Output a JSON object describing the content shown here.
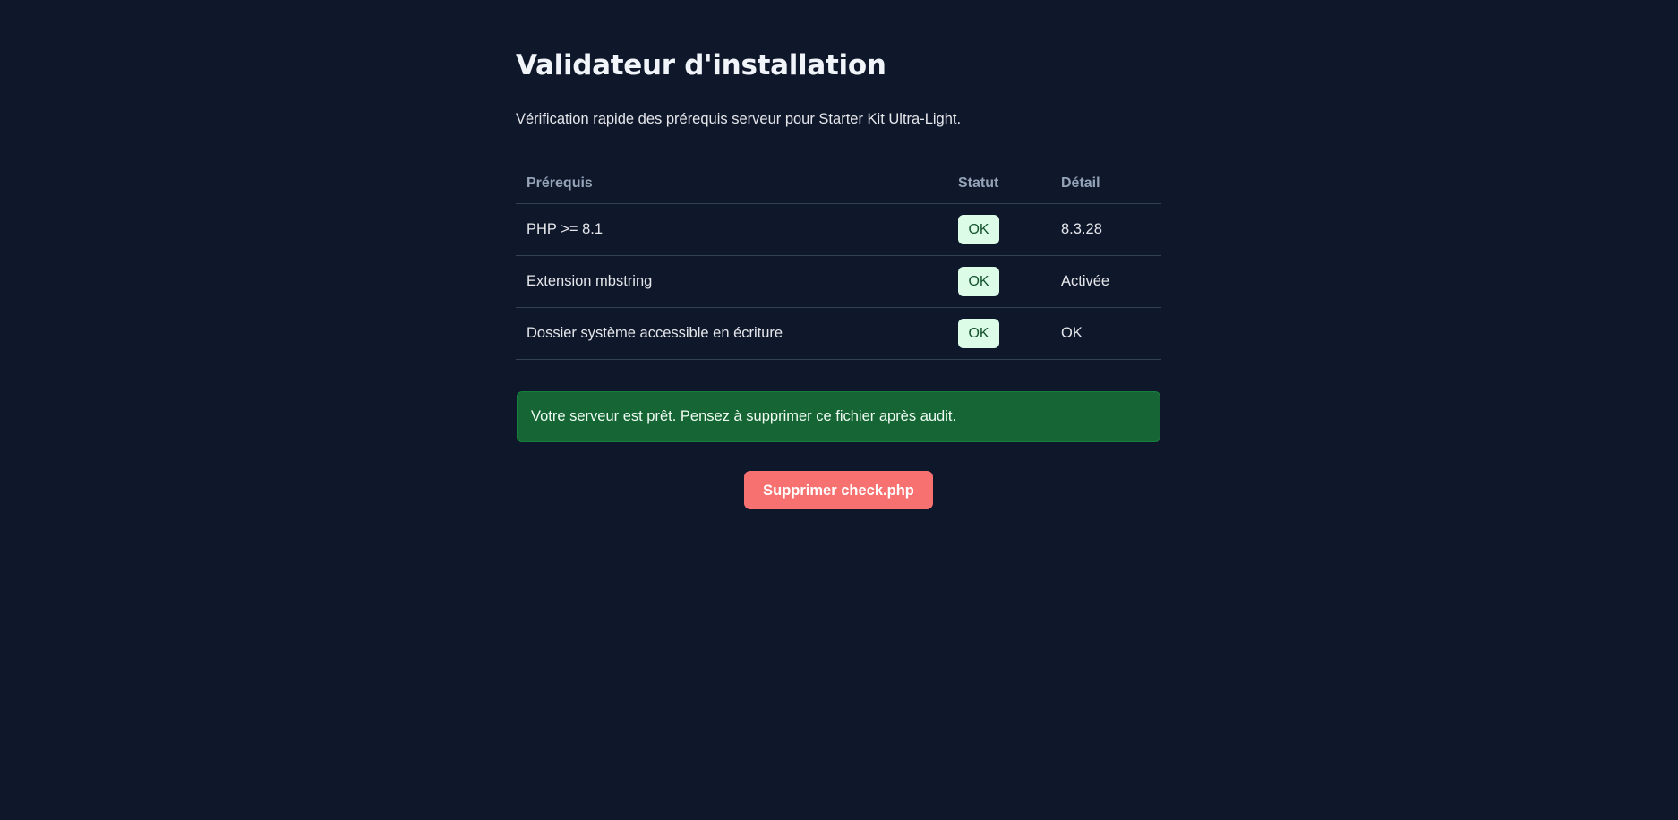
{
  "page": {
    "title": "Validateur d'installation",
    "subtitle": "Vérification rapide des prérequis serveur pour Starter Kit Ultra-Light."
  },
  "table": {
    "headers": [
      "Prérequis",
      "Statut",
      "Détail"
    ],
    "rows": [
      {
        "requirement": "PHP >= 8.1",
        "status": "OK",
        "detail": "8.3.28"
      },
      {
        "requirement": "Extension mbstring",
        "status": "OK",
        "detail": "Activée"
      },
      {
        "requirement": "Dossier système accessible en écriture",
        "status": "OK",
        "detail": "OK"
      }
    ]
  },
  "alert": {
    "message": "Votre serveur est prêt. Pensez à supprimer ce fichier après audit."
  },
  "actions": {
    "delete_label": "Supprimer check.php"
  },
  "colors": {
    "background": "#0f172a",
    "badge_bg": "#dcfce7",
    "alert_bg": "#166534",
    "button_bg": "#f87171"
  }
}
